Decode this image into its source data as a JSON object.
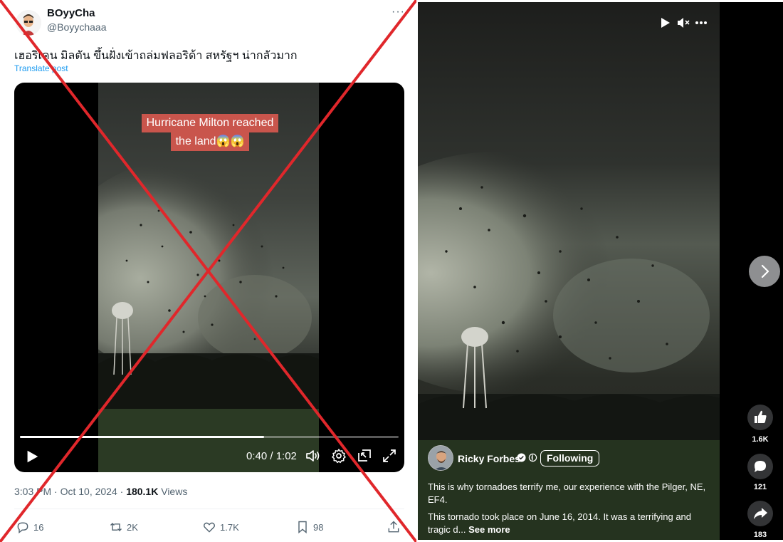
{
  "tweet": {
    "author_name": "BOyyCha",
    "author_handle": "@Boyychaaa",
    "more": "···",
    "text": "เฮอริเคน มิลตัน ขึ้นฝั่งเข้าถล่มฟลอริด้า สหรัฐฯ น่ากลัวมาก",
    "translate": "Translate post",
    "video": {
      "caption_line1": "Hurricane Milton reached",
      "caption_line2": "the land😱😱",
      "time": "0:40 / 1:02",
      "progress": 0.645
    },
    "meta_time": "3:03 PM · Oct 10, 2024 · ",
    "meta_views": "180.1K",
    "meta_views_label": " Views",
    "actions": {
      "replies": "16",
      "reposts": "2K",
      "likes": "1.7K",
      "bookmarks": "98"
    },
    "overlay_color": "#e0272b"
  },
  "reel": {
    "author": "Ricky Forbes",
    "follow_label": "Following",
    "description": "This is why tornadoes terrify me, our experience with the Pilger, NE, EF4.",
    "description2": "This tornado took place on June 16, 2014. It was a terrifying and tragic d...",
    "see_more": " See more",
    "likes": "1.6K",
    "comments": "121",
    "shares": "183"
  }
}
